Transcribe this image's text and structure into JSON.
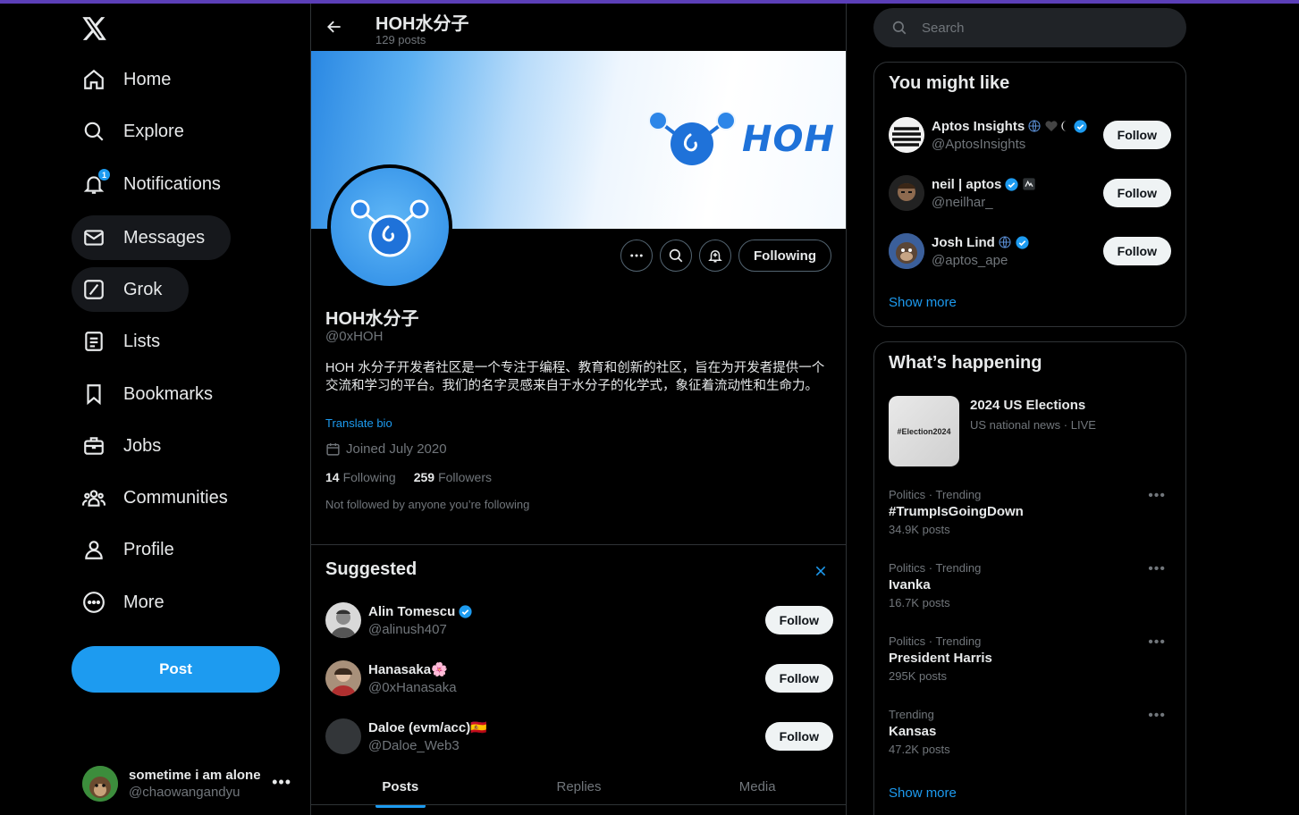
{
  "nav": {
    "items": [
      {
        "label": "Home",
        "icon": "home-icon"
      },
      {
        "label": "Explore",
        "icon": "search-icon"
      },
      {
        "label": "Notifications",
        "icon": "bell-icon",
        "badge": "1"
      },
      {
        "label": "Messages",
        "icon": "envelope-icon"
      },
      {
        "label": "Grok",
        "icon": "grok-icon"
      },
      {
        "label": "Lists",
        "icon": "list-icon"
      },
      {
        "label": "Bookmarks",
        "icon": "bookmark-icon"
      },
      {
        "label": "Jobs",
        "icon": "briefcase-icon"
      },
      {
        "label": "Communities",
        "icon": "people-icon"
      },
      {
        "label": "Profile",
        "icon": "person-icon"
      },
      {
        "label": "More",
        "icon": "more-circle-icon"
      }
    ],
    "post_label": "Post",
    "account": {
      "name": "sometime i am alone",
      "handle": "@chaowangandyu"
    }
  },
  "header": {
    "title": "HOH水分子",
    "posts_count": "129 posts"
  },
  "banner": {
    "wordmark": "HOH"
  },
  "profile": {
    "name": "HOH水分子",
    "handle": "@0xHOH",
    "bio": "HOH 水分子开发者社区是一个专注于编程、教育和创新的社区，旨在为开发者提供一个交流和学习的平台。我们的名字灵感来自于水分子的化学式，象征着流动性和生命力。",
    "translate_label": "Translate bio",
    "joined": "Joined July 2020",
    "following_count": "14",
    "following_label": "Following",
    "followers_count": "259",
    "followers_label": "Followers",
    "not_followed": "Not followed by anyone you’re following",
    "following_button": "Following"
  },
  "suggested": {
    "title": "Suggested",
    "users": [
      {
        "name": "Alin Tomescu",
        "handle": "@alinush407",
        "follow": "Follow"
      },
      {
        "name": "Hanasaka🌸",
        "handle": "@0xHanasaka",
        "follow": "Follow"
      },
      {
        "name": "Daloe (evm/acc)🇪🇸",
        "handle": "@Daloe_Web3",
        "follow": "Follow"
      }
    ]
  },
  "tabs": [
    "Posts",
    "Replies",
    "Media"
  ],
  "search": {
    "placeholder": "Search"
  },
  "might_like": {
    "title": "You might like",
    "users": [
      {
        "name": "Aptos Insights",
        "handle": "@AptosInsights",
        "follow": "Follow"
      },
      {
        "name": "neil | aptos",
        "handle": "@neilhar_",
        "follow": "Follow"
      },
      {
        "name": "Josh Lind",
        "handle": "@aptos_ape",
        "follow": "Follow"
      }
    ],
    "show_more": "Show more"
  },
  "happening": {
    "title": "What’s happening",
    "news": {
      "image_text": "#Election2024",
      "title": "2024 US Elections",
      "sub": "US national news · LIVE"
    },
    "trends": [
      {
        "meta": "Politics · Trending",
        "name": "#TrumpIsGoingDown",
        "count": "34.9K posts"
      },
      {
        "meta": "Politics · Trending",
        "name": "Ivanka",
        "count": "16.7K posts"
      },
      {
        "meta": "Politics · Trending",
        "name": "President Harris",
        "count": "295K posts"
      },
      {
        "meta": "Trending",
        "name": "Kansas",
        "count": "47.2K posts"
      }
    ],
    "show_more": "Show more"
  },
  "colors": {
    "accent": "#1d9bf0",
    "background": "#000000",
    "border": "#2f3336",
    "muted": "#71767b"
  }
}
